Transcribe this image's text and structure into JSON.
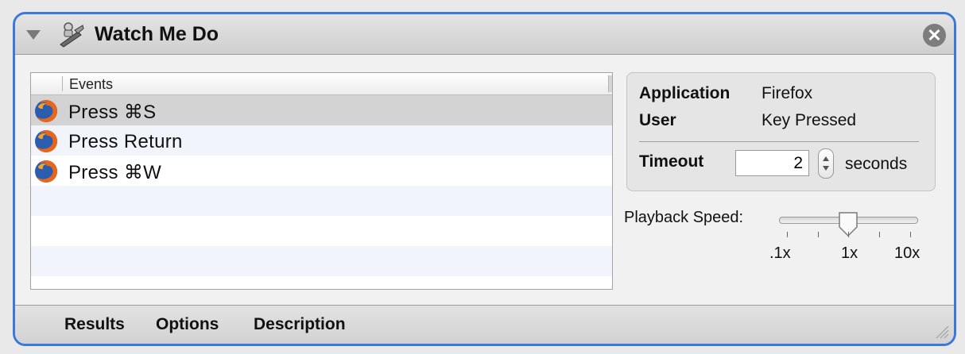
{
  "header": {
    "title": "Watch Me Do"
  },
  "events": {
    "column_header": "Events",
    "rows": [
      {
        "label": "Press ⌘S",
        "icon": "firefox-icon"
      },
      {
        "label": "Press Return",
        "icon": "firefox-icon"
      },
      {
        "label": "Press ⌘W",
        "icon": "firefox-icon"
      }
    ],
    "selected_index": 0
  },
  "details": {
    "application_label": "Application",
    "application_value": "Firefox",
    "user_label": "User",
    "user_value": "Key Pressed",
    "timeout_label": "Timeout",
    "timeout_value": "2",
    "timeout_unit": "seconds"
  },
  "playback": {
    "label": "Playback Speed:",
    "tick_labels": [
      ".1x",
      "1x",
      "10x"
    ],
    "current_value": "1x"
  },
  "footer": {
    "tabs": [
      "Results",
      "Options",
      "Description"
    ]
  },
  "colors": {
    "accent": "#3c78d8",
    "selection": "#d3d3d3",
    "alt_row": "#f1f5fb"
  }
}
